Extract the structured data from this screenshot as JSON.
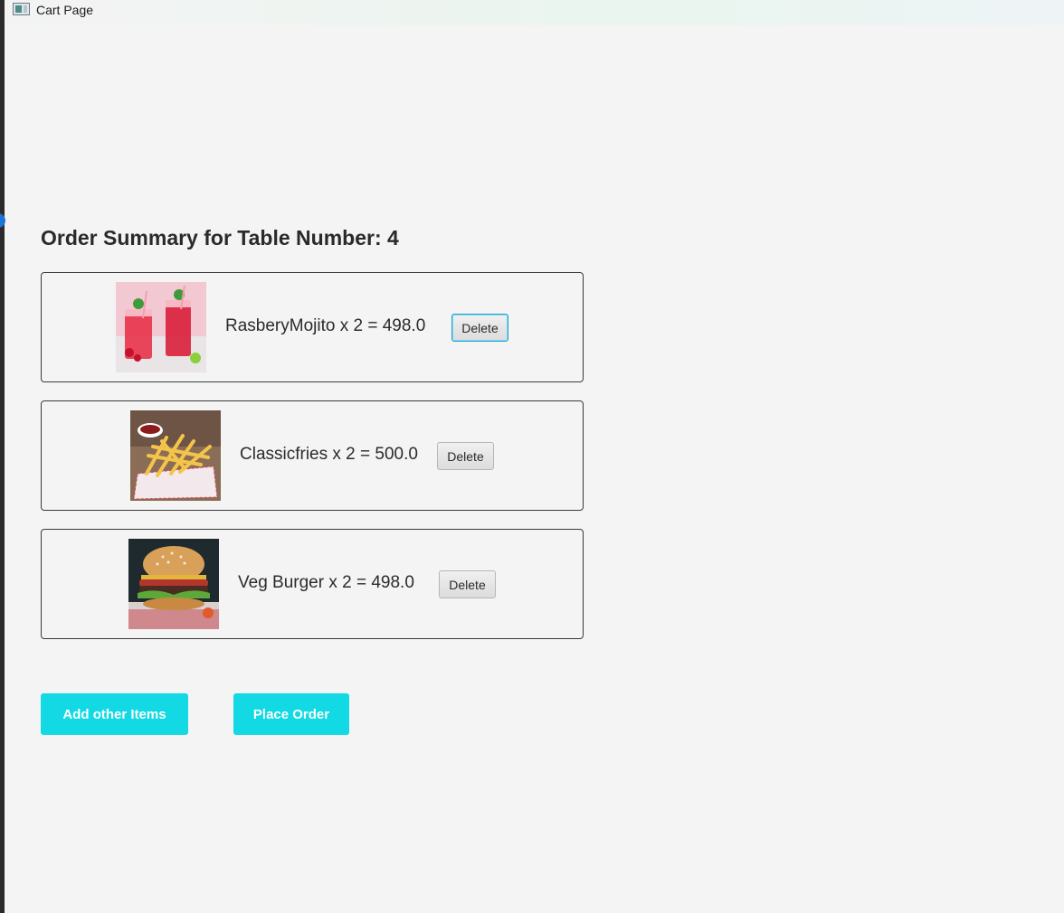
{
  "window": {
    "title": "Cart Page"
  },
  "order": {
    "heading": "Order Summary for Table Number: 4",
    "items": [
      {
        "label": "RasberyMojito x 2 = 498.0",
        "image": "raspberry-mojito-photo",
        "delete_label": "Delete"
      },
      {
        "label": "Classicfries x 2 = 500.0",
        "image": "classic-fries-photo",
        "delete_label": "Delete"
      },
      {
        "label": "Veg Burger x 2 = 498.0",
        "image": "veg-burger-photo",
        "delete_label": "Delete"
      }
    ]
  },
  "actions": {
    "add_items_label": "Add other Items",
    "place_order_label": "Place Order"
  },
  "colors": {
    "accent": "#12d9e3",
    "background": "#f4f4f4",
    "focus_ring": "#1aa3d6"
  }
}
